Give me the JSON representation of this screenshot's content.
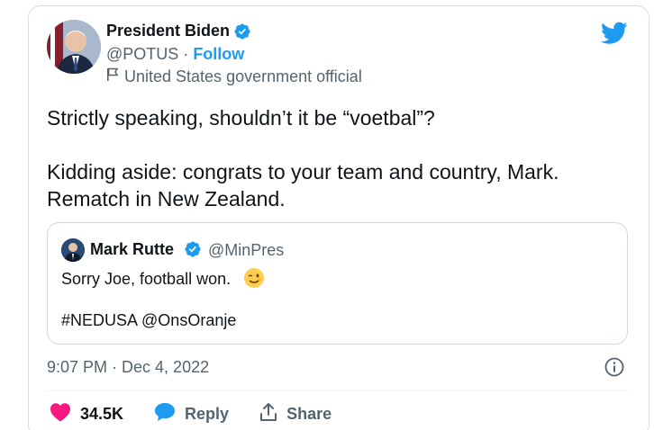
{
  "author": {
    "name": "President Biden",
    "handle": "@POTUS",
    "separator": "·",
    "follow_label": "Follow",
    "affiliation_label": "United States government official"
  },
  "tweet": {
    "paragraph1": "Strictly speaking, shouldn’t it be “voetbal”?",
    "paragraph2_line1": "Kidding aside: congrats to your team and country, Mark.",
    "paragraph2_line2": "Rematch in New Zealand."
  },
  "quoted": {
    "name": "Mark Rutte",
    "handle": "@MinPres",
    "text": "Sorry Joe, football won.",
    "hashtags": "#NEDUSA @OnsOranje"
  },
  "meta": {
    "timestamp": "9:07 PM · Dec 4, 2022"
  },
  "actions": {
    "likes": "34.5K",
    "reply_label": "Reply",
    "share_label": "Share"
  },
  "colors": {
    "brand_blue": "#1d9bf0",
    "like_pink": "#f91880",
    "text_secondary": "#536471"
  },
  "icons": [
    "verified-badge-icon",
    "flag-icon",
    "twitter-bird-icon",
    "wink-emoji-icon",
    "info-icon",
    "heart-icon",
    "reply-bubble-icon",
    "share-icon"
  ]
}
